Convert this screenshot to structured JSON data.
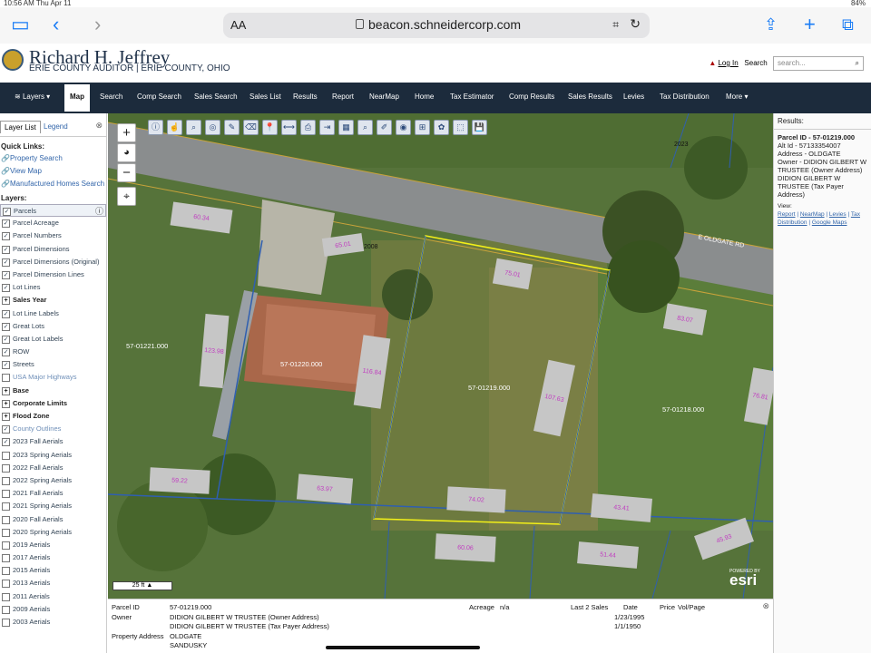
{
  "statusbar": {
    "time": "10:56 AM  Thu Apr 11",
    "battery": "84%"
  },
  "safari": {
    "aa": "AA",
    "url": "beacon.schneidercorp.com"
  },
  "site": {
    "title": "Richard H. Jeffrey",
    "subtitle": "ERIE COUNTY AUDITOR  |  ERIE COUNTY, OHIO",
    "login": "Log In",
    "search_label": "Search",
    "search_placeholder": "search..."
  },
  "nav": [
    "Layers",
    "Map",
    "Search",
    "Comp Search",
    "Sales Search",
    "Sales List",
    "Results",
    "Report",
    "NearMap",
    "Home",
    "Tax Estimator",
    "Comp Results",
    "Sales Results",
    "Levies",
    "Tax Distribution",
    "More"
  ],
  "left": {
    "tabs": [
      "Layer List",
      "Legend"
    ],
    "quick_links_title": "Quick Links:",
    "quick_links": [
      "Property Search",
      "View Map",
      "Manufactured Homes Search"
    ],
    "layers_title": "Layers:",
    "layers": [
      {
        "label": "Parcels",
        "checked": true,
        "group": false,
        "info": true
      },
      {
        "label": "Parcel Acreage",
        "checked": true,
        "group": false
      },
      {
        "label": "Parcel Numbers",
        "checked": true,
        "group": false
      },
      {
        "label": "Parcel Dimensions",
        "checked": true,
        "group": false
      },
      {
        "label": "Parcel Dimensions (Original)",
        "checked": true,
        "group": false
      },
      {
        "label": "Parcel Dimension Lines",
        "checked": true,
        "group": false
      },
      {
        "label": "Lot Lines",
        "checked": true,
        "group": false
      },
      {
        "label": "Sales Year",
        "checked": false,
        "group": true
      },
      {
        "label": "Lot Line Labels",
        "checked": true,
        "group": false
      },
      {
        "label": "Great Lots",
        "checked": true,
        "group": false
      },
      {
        "label": "Great Lot Labels",
        "checked": true,
        "group": false
      },
      {
        "label": "ROW",
        "checked": true,
        "group": false
      },
      {
        "label": "Streets",
        "checked": true,
        "group": false
      },
      {
        "label": "USA Major Highways",
        "checked": false,
        "group": false
      },
      {
        "label": "Base",
        "checked": false,
        "group": true
      },
      {
        "label": "Corporate Limits",
        "checked": false,
        "group": true
      },
      {
        "label": "Flood Zone",
        "checked": false,
        "group": true
      },
      {
        "label": "County Outlines",
        "checked": true,
        "group": false
      },
      {
        "label": "2023 Fall Aerials",
        "checked": true,
        "group": false
      },
      {
        "label": "2023 Spring Aerials",
        "checked": false,
        "group": false
      },
      {
        "label": "2022 Fall Aerials",
        "checked": false,
        "group": false
      },
      {
        "label": "2022 Spring Aerials",
        "checked": false,
        "group": false
      },
      {
        "label": "2021 Fall Aerials",
        "checked": false,
        "group": false
      },
      {
        "label": "2021 Spring Aerials",
        "checked": false,
        "group": false
      },
      {
        "label": "2020 Fall Aerials",
        "checked": false,
        "group": false
      },
      {
        "label": "2020 Spring Aerials",
        "checked": false,
        "group": false
      },
      {
        "label": "2019 Aerials",
        "checked": false,
        "group": false
      },
      {
        "label": "2017 Aerials",
        "checked": false,
        "group": false
      },
      {
        "label": "2015 Aerials",
        "checked": false,
        "group": false
      },
      {
        "label": "2013 Aerials",
        "checked": false,
        "group": false
      },
      {
        "label": "2011 Aerials",
        "checked": false,
        "group": false
      },
      {
        "label": "2009 Aerials",
        "checked": false,
        "group": false
      },
      {
        "label": "2003 Aerials",
        "checked": false,
        "group": false
      }
    ]
  },
  "map": {
    "street_label": "E OLDGATE RD",
    "parcels": [
      "57-01221.000",
      "57-01220.000",
      "57-01219.000",
      "57-01218.000"
    ],
    "acreage": [
      "60.34",
      "65.01",
      "75.01",
      "123.98",
      "116.84",
      "107.63",
      "83.07",
      "76.81",
      "59.22",
      "63.97",
      "74.02",
      "43.41",
      "60.06",
      "51.44",
      "45.93"
    ],
    "address_numbers": [
      "2008",
      "2023"
    ],
    "scale": "25 ft",
    "esri_powered": "POWERED BY",
    "esri": "esri"
  },
  "results": {
    "title": "Results:",
    "parcel_id": "Parcel ID - 57-01219.000",
    "alt_id": "Alt Id - 57133354007",
    "address": "Address - OLDGATE",
    "owner": "Owner - DIDION GILBERT W TRUSTEE (Owner Address)",
    "owner2": "DIDION GILBERT W TRUSTEE (Tax Payer Address)",
    "view": "View:",
    "links": [
      "Report",
      "NearMap",
      "Levies",
      "Tax Distribution",
      "Google Maps"
    ]
  },
  "bottom": {
    "parcel_id_label": "Parcel ID",
    "parcel_id": "57-01219.000",
    "owner_label": "Owner",
    "owner1": "DIDION GILBERT W TRUSTEE (Owner Address)",
    "owner2": "DIDION GILBERT W TRUSTEE (Tax Payer Address)",
    "addr_label": "Property Address",
    "addr1": "OLDGATE",
    "addr2": "SANDUSKY",
    "acreage_label": "Acreage",
    "acreage": "n/a",
    "sales_label": "Last 2 Sales",
    "date_label": "Date",
    "price_label": "Price",
    "volpage_label": "Vol/Page",
    "sale_dates": [
      "1/23/1995",
      "1/1/1950"
    ]
  }
}
